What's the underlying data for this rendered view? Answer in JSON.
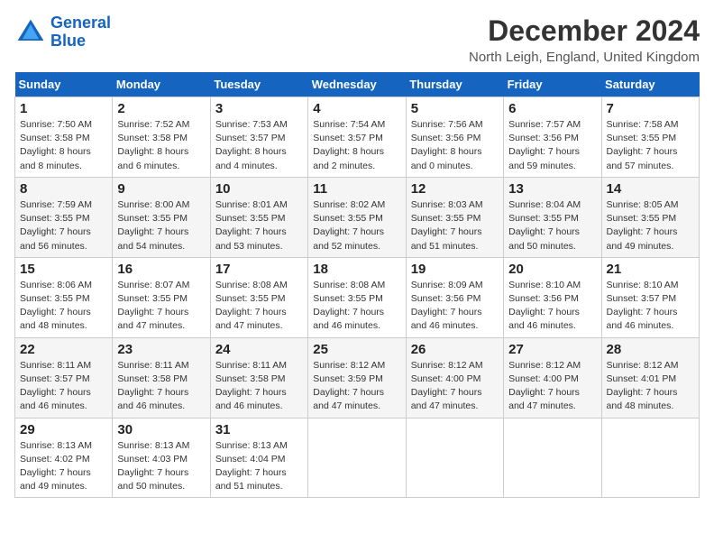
{
  "logo": {
    "line1": "General",
    "line2": "Blue"
  },
  "title": "December 2024",
  "location": "North Leigh, England, United Kingdom",
  "days_of_week": [
    "Sunday",
    "Monday",
    "Tuesday",
    "Wednesday",
    "Thursday",
    "Friday",
    "Saturday"
  ],
  "weeks": [
    [
      {
        "day": "1",
        "sunrise": "7:50 AM",
        "sunset": "3:58 PM",
        "daylight": "8 hours and 8 minutes."
      },
      {
        "day": "2",
        "sunrise": "7:52 AM",
        "sunset": "3:58 PM",
        "daylight": "8 hours and 6 minutes."
      },
      {
        "day": "3",
        "sunrise": "7:53 AM",
        "sunset": "3:57 PM",
        "daylight": "8 hours and 4 minutes."
      },
      {
        "day": "4",
        "sunrise": "7:54 AM",
        "sunset": "3:57 PM",
        "daylight": "8 hours and 2 minutes."
      },
      {
        "day": "5",
        "sunrise": "7:56 AM",
        "sunset": "3:56 PM",
        "daylight": "8 hours and 0 minutes."
      },
      {
        "day": "6",
        "sunrise": "7:57 AM",
        "sunset": "3:56 PM",
        "daylight": "7 hours and 59 minutes."
      },
      {
        "day": "7",
        "sunrise": "7:58 AM",
        "sunset": "3:55 PM",
        "daylight": "7 hours and 57 minutes."
      }
    ],
    [
      {
        "day": "8",
        "sunrise": "7:59 AM",
        "sunset": "3:55 PM",
        "daylight": "7 hours and 56 minutes."
      },
      {
        "day": "9",
        "sunrise": "8:00 AM",
        "sunset": "3:55 PM",
        "daylight": "7 hours and 54 minutes."
      },
      {
        "day": "10",
        "sunrise": "8:01 AM",
        "sunset": "3:55 PM",
        "daylight": "7 hours and 53 minutes."
      },
      {
        "day": "11",
        "sunrise": "8:02 AM",
        "sunset": "3:55 PM",
        "daylight": "7 hours and 52 minutes."
      },
      {
        "day": "12",
        "sunrise": "8:03 AM",
        "sunset": "3:55 PM",
        "daylight": "7 hours and 51 minutes."
      },
      {
        "day": "13",
        "sunrise": "8:04 AM",
        "sunset": "3:55 PM",
        "daylight": "7 hours and 50 minutes."
      },
      {
        "day": "14",
        "sunrise": "8:05 AM",
        "sunset": "3:55 PM",
        "daylight": "7 hours and 49 minutes."
      }
    ],
    [
      {
        "day": "15",
        "sunrise": "8:06 AM",
        "sunset": "3:55 PM",
        "daylight": "7 hours and 48 minutes."
      },
      {
        "day": "16",
        "sunrise": "8:07 AM",
        "sunset": "3:55 PM",
        "daylight": "7 hours and 47 minutes."
      },
      {
        "day": "17",
        "sunrise": "8:08 AM",
        "sunset": "3:55 PM",
        "daylight": "7 hours and 47 minutes."
      },
      {
        "day": "18",
        "sunrise": "8:08 AM",
        "sunset": "3:55 PM",
        "daylight": "7 hours and 46 minutes."
      },
      {
        "day": "19",
        "sunrise": "8:09 AM",
        "sunset": "3:56 PM",
        "daylight": "7 hours and 46 minutes."
      },
      {
        "day": "20",
        "sunrise": "8:10 AM",
        "sunset": "3:56 PM",
        "daylight": "7 hours and 46 minutes."
      },
      {
        "day": "21",
        "sunrise": "8:10 AM",
        "sunset": "3:57 PM",
        "daylight": "7 hours and 46 minutes."
      }
    ],
    [
      {
        "day": "22",
        "sunrise": "8:11 AM",
        "sunset": "3:57 PM",
        "daylight": "7 hours and 46 minutes."
      },
      {
        "day": "23",
        "sunrise": "8:11 AM",
        "sunset": "3:58 PM",
        "daylight": "7 hours and 46 minutes."
      },
      {
        "day": "24",
        "sunrise": "8:11 AM",
        "sunset": "3:58 PM",
        "daylight": "7 hours and 46 minutes."
      },
      {
        "day": "25",
        "sunrise": "8:12 AM",
        "sunset": "3:59 PM",
        "daylight": "7 hours and 47 minutes."
      },
      {
        "day": "26",
        "sunrise": "8:12 AM",
        "sunset": "4:00 PM",
        "daylight": "7 hours and 47 minutes."
      },
      {
        "day": "27",
        "sunrise": "8:12 AM",
        "sunset": "4:00 PM",
        "daylight": "7 hours and 47 minutes."
      },
      {
        "day": "28",
        "sunrise": "8:12 AM",
        "sunset": "4:01 PM",
        "daylight": "7 hours and 48 minutes."
      }
    ],
    [
      {
        "day": "29",
        "sunrise": "8:13 AM",
        "sunset": "4:02 PM",
        "daylight": "7 hours and 49 minutes."
      },
      {
        "day": "30",
        "sunrise": "8:13 AM",
        "sunset": "4:03 PM",
        "daylight": "7 hours and 50 minutes."
      },
      {
        "day": "31",
        "sunrise": "8:13 AM",
        "sunset": "4:04 PM",
        "daylight": "7 hours and 51 minutes."
      },
      null,
      null,
      null,
      null
    ]
  ]
}
